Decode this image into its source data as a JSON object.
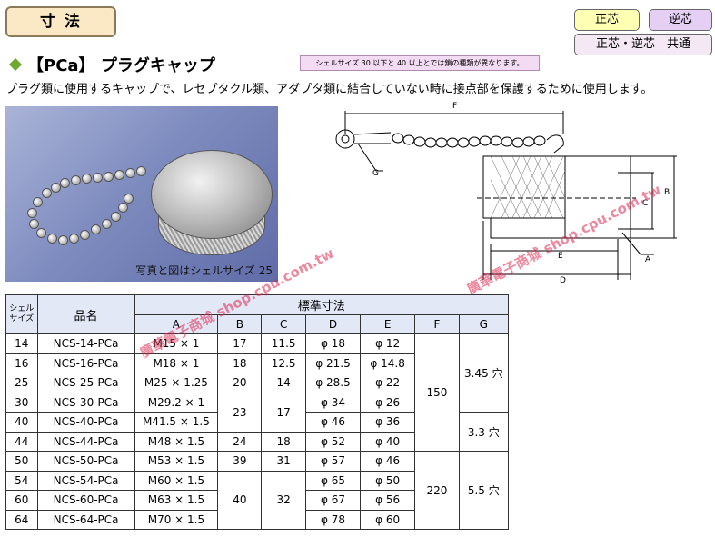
{
  "header": {
    "section_title": "寸 法",
    "badge_male": "正芯",
    "badge_female": "逆芯",
    "badge_common": "正芯・逆芯　共通"
  },
  "product": {
    "title": "【PCa】 プラグキャップ",
    "note": "シェルサイズ 30 以下と 40 以上とでは鎖の種類が異なります。",
    "description": "プラグ類に使用するキャップで、レセプタクル類、アダプタ類に結合していない時に接点部を保護するために使用します。",
    "photo_caption": "写真と図はシェルサイズ 25"
  },
  "drawing": {
    "labels": [
      "F",
      "G",
      "B",
      "C",
      "A",
      "E",
      "D"
    ]
  },
  "watermarks": [
    "廣華電子商城 shop.cpu.com.tw",
    "廣華電子商城 shop.cpu.com.tw"
  ],
  "table": {
    "header_shell": "シェル\nサイズ",
    "header_name": "品名",
    "header_std": "標準寸法",
    "cols": [
      "A",
      "B",
      "C",
      "D",
      "E",
      "F",
      "G"
    ],
    "rows": [
      {
        "shell": "14",
        "name": "NCS-14-PCa",
        "A": "M15 × 1",
        "B": "17",
        "C": "11.5",
        "D": "φ 18",
        "E": "φ 12"
      },
      {
        "shell": "16",
        "name": "NCS-16-PCa",
        "A": "M18 × 1",
        "B": "18",
        "C": "12.5",
        "D": "φ 21.5",
        "E": "φ 14.8"
      },
      {
        "shell": "25",
        "name": "NCS-25-PCa",
        "A": "M25 × 1.25",
        "B": "20",
        "C": "14",
        "D": "φ 28.5",
        "E": "φ 22"
      },
      {
        "shell": "30",
        "name": "NCS-30-PCa",
        "A": "M29.2 × 1",
        "B": "",
        "C": "",
        "D": "φ 34",
        "E": "φ 26"
      },
      {
        "shell": "40",
        "name": "NCS-40-PCa",
        "A": "M41.5 × 1.5",
        "B": "",
        "C": "",
        "D": "φ 46",
        "E": "φ 36"
      },
      {
        "shell": "44",
        "name": "NCS-44-PCa",
        "A": "M48 × 1.5",
        "B": "24",
        "C": "18",
        "D": "φ 52",
        "E": "φ 40"
      },
      {
        "shell": "50",
        "name": "NCS-50-PCa",
        "A": "M53 × 1.5",
        "B": "39",
        "C": "31",
        "D": "φ 57",
        "E": "φ 46"
      },
      {
        "shell": "54",
        "name": "NCS-54-PCa",
        "A": "M60 × 1.5",
        "B": "",
        "C": "",
        "D": "φ 65",
        "E": "φ 50"
      },
      {
        "shell": "60",
        "name": "NCS-60-PCa",
        "A": "M63 × 1.5",
        "B": "",
        "C": "",
        "D": "φ 67",
        "E": "φ 56"
      },
      {
        "shell": "64",
        "name": "NCS-64-PCa",
        "A": "M70 × 1.5",
        "B": "",
        "C": "",
        "D": "φ 78",
        "E": "φ 60"
      }
    ],
    "merged": {
      "B_30_40": "23",
      "C_30_40": "17",
      "B_54_64": "40",
      "C_54_64": "32",
      "F_14_44": "150",
      "F_50_64": "220",
      "G_14_30": "3.45 穴",
      "G_40_44": "3.3 穴",
      "G_50_64": "5.5 穴"
    }
  }
}
